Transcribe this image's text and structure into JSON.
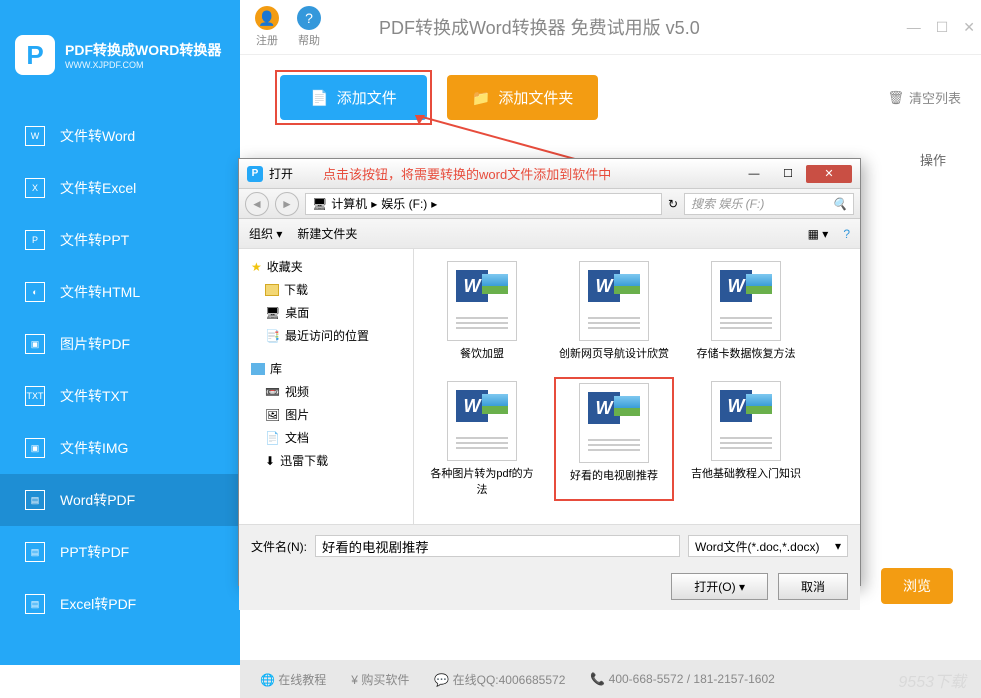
{
  "header": {
    "logo_letter": "P",
    "logo_title": "PDF转换成WORD转换器",
    "logo_url": "WWW.XJPDF.COM",
    "register": "注册",
    "help": "帮助",
    "app_title": "PDF转换成Word转换器 免费试用版 v5.0"
  },
  "toolbar": {
    "add_file": "添加文件",
    "add_folder": "添加文件夹",
    "clear_list": "清空列表"
  },
  "columns": {
    "ops": "操作"
  },
  "sidebar": {
    "items": [
      {
        "icon": "W",
        "label": "文件转Word"
      },
      {
        "icon": "X",
        "label": "文件转Excel"
      },
      {
        "icon": "P",
        "label": "文件转PPT"
      },
      {
        "icon": "◐",
        "label": "文件转HTML"
      },
      {
        "icon": "▣",
        "label": "图片转PDF"
      },
      {
        "icon": "TXT",
        "label": "文件转TXT"
      },
      {
        "icon": "▣",
        "label": "文件转IMG"
      },
      {
        "icon": "▤",
        "label": "Word转PDF",
        "active": true
      },
      {
        "icon": "▤",
        "label": "PPT转PDF"
      },
      {
        "icon": "▤",
        "label": "Excel转PDF"
      }
    ]
  },
  "annotation": "点击该按钮，将需要转换的word文件添加到软件中",
  "dialog": {
    "title": "打开",
    "breadcrumb": [
      "计算机",
      "娱乐 (F:)"
    ],
    "search_placeholder": "搜索 娱乐 (F:)",
    "toolbar": {
      "organize": "组织 ▾",
      "new_folder": "新建文件夹"
    },
    "tree": {
      "favorites": "收藏夹",
      "downloads": "下载",
      "desktop": "桌面",
      "recent": "最近访问的位置",
      "library": "库",
      "video": "视频",
      "pictures": "图片",
      "docs": "文档",
      "xunlei": "迅雷下载"
    },
    "files": [
      {
        "name": "餐饮加盟"
      },
      {
        "name": "创新网页导航设计欣赏"
      },
      {
        "name": "存储卡数据恢复方法"
      },
      {
        "name": "各种图片转为pdf的方法"
      },
      {
        "name": "好看的电视剧推荐",
        "selected": true
      },
      {
        "name": "吉他基础教程入门知识"
      }
    ],
    "filename_label": "文件名(N):",
    "filename_value": "好看的电视剧推荐",
    "filter": "Word文件(*.doc,*.docx)",
    "open_btn": "打开(O)",
    "cancel_btn": "取消"
  },
  "browse": "浏览",
  "footer": {
    "tutorial": "在线教程",
    "buy": "购买软件",
    "qq_label": "在线QQ:",
    "qq": "4006685572",
    "phone": "400-668-5572",
    "other": "181-2157-1602"
  },
  "watermark": "9553下载"
}
